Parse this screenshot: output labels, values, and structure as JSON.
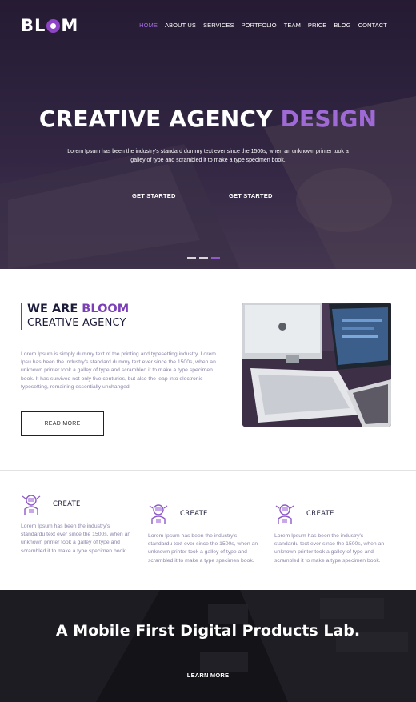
{
  "brand": {
    "name_prefix": "BL",
    "name_suffix": "M",
    "accent": "#8e44c6"
  },
  "nav": {
    "items": [
      {
        "label": "HOME",
        "active": true
      },
      {
        "label": "ABOUT US"
      },
      {
        "label": "SERVICES"
      },
      {
        "label": "PORTFOLIO"
      },
      {
        "label": "TEAM"
      },
      {
        "label": "PRICE"
      },
      {
        "label": "BLOG"
      },
      {
        "label": "CONTACT"
      }
    ]
  },
  "hero": {
    "title_main": "CREATIVE AGENCY ",
    "title_accent": "DESIGN",
    "text": "Lorem Ipsum has been the industry's standard dummy text ever since the 1500s, when an unknown printer took a galley of type and scrambled it to make a type specimen book.",
    "button1": "GET STARTED",
    "button2": "GET STARTED",
    "slides_total": 3,
    "slide_active": 3
  },
  "about": {
    "heading_prefix": "WE ARE ",
    "heading_accent": "BLOOM",
    "subheading": "CREATIVE AGENCY",
    "text": "Lorem Ipsum is simply dummy text of the printing and typesetting industry. Lorem Ipsu has been the industry's standard dummy text ever since the 1500s, when an unknown printer took a galley of type and scrambled it to make a type specimen book. It has survived not only five centuries, but also the leap into electronic typesetting, remaining essentially unchanged.",
    "button": "READ MORE"
  },
  "features": [
    {
      "icon": "robot-icon",
      "title": "CREATE",
      "text": "Lorem Ipsum has been the industry's standardu text ever since the 1500s, when an unknown printer took a galley of type and scrambled it to make a type specimen book."
    },
    {
      "icon": "robot-icon",
      "title": "CREATE",
      "text": "Lorem Ipsum has been the industry's standardu text ever since the 1500s, when an unknown printer took a galley of type and scrambled it to make a type specimen book."
    },
    {
      "icon": "robot-icon",
      "title": "CREATE",
      "text": "Lorem Ipsum has been the industry's standardu text ever since the 1500s, when an unknown printer took a galley of type and scrambled it to make a type specimen book."
    }
  ],
  "cta": {
    "title": "A Mobile First Digital Products Lab.",
    "button": "LEARN MORE"
  },
  "colors": {
    "accent": "#8e44c6",
    "heading": "#1b1b3a",
    "body_text": "#8a86a8"
  }
}
